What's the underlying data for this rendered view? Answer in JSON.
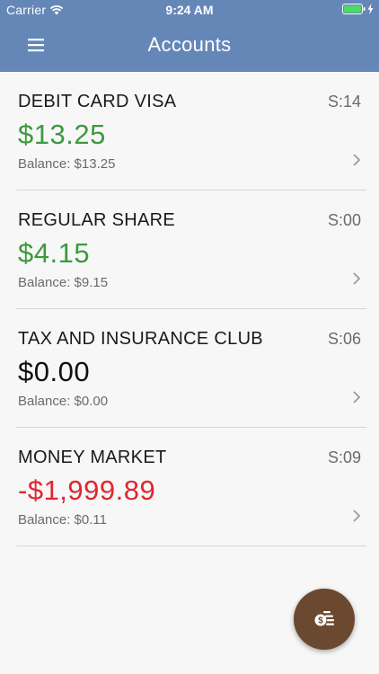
{
  "status_bar": {
    "carrier": "Carrier",
    "time": "9:24 AM"
  },
  "nav": {
    "title": "Accounts"
  },
  "colors": {
    "header": "#6587b8",
    "positive": "#3d9a3d",
    "neutral": "#111111",
    "negative": "#e0262e",
    "fab": "#6b4830",
    "battery": "#4cd964"
  },
  "accounts": [
    {
      "name": "DEBIT CARD VISA",
      "share": "S:14",
      "amount": "$13.25",
      "amount_status": "positive",
      "balance": "Balance: $13.25"
    },
    {
      "name": "REGULAR SHARE",
      "share": "S:00",
      "amount": "$4.15",
      "amount_status": "positive",
      "balance": "Balance: $9.15"
    },
    {
      "name": "TAX AND INSURANCE CLUB",
      "share": "S:06",
      "amount": "$0.00",
      "amount_status": "neutral",
      "balance": "Balance: $0.00"
    },
    {
      "name": "MONEY MARKET",
      "share": "S:09",
      "amount": "-$1,999.89",
      "amount_status": "negative",
      "balance": "Balance: $0.11"
    }
  ],
  "fab": {
    "icon": "money-transfer-icon"
  }
}
